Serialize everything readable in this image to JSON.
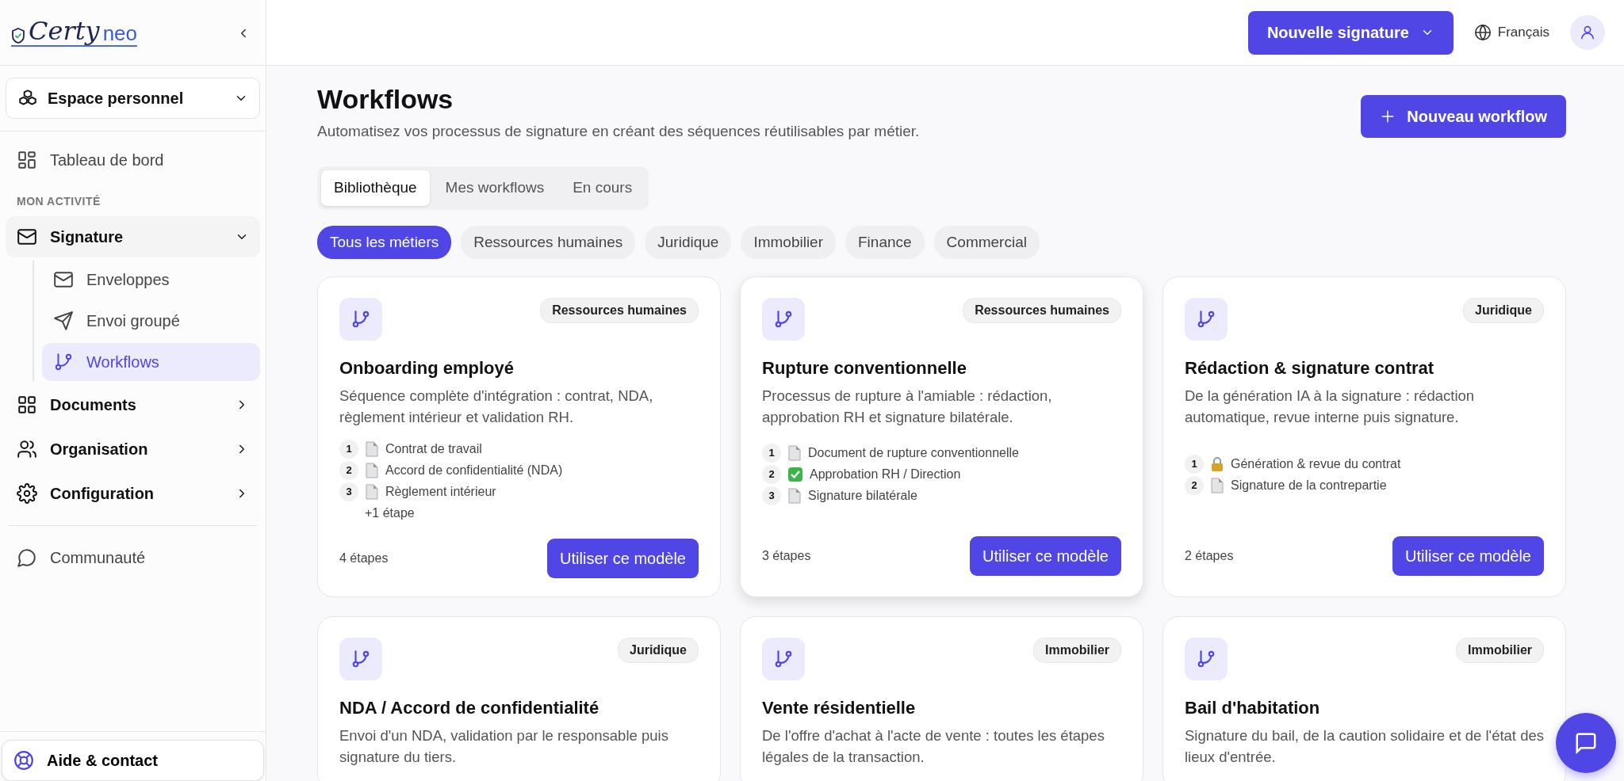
{
  "sidebar": {
    "logo": {
      "part_1": "Certy",
      "part_2": "neo"
    },
    "workspace": "Espace personnel",
    "nav": [
      {
        "kind": "item",
        "label": "Tableau de bord"
      },
      {
        "kind": "heading",
        "label": "MON ACTIVITÉ"
      },
      {
        "kind": "group",
        "label": "Signature",
        "expanded": true,
        "children": [
          {
            "label": "Enveloppes",
            "selected": false
          },
          {
            "label": "Envoi groupé",
            "selected": false
          },
          {
            "label": "Workflows",
            "selected": true
          }
        ]
      },
      {
        "kind": "group",
        "label": "Documents",
        "expanded": false
      },
      {
        "kind": "group",
        "label": "Organisation",
        "expanded": false
      },
      {
        "kind": "group",
        "label": "Configuration",
        "expanded": false
      },
      {
        "kind": "divider"
      },
      {
        "kind": "item",
        "label": "Communauté"
      }
    ],
    "help": "Aide & contact"
  },
  "header": {
    "new_signature": "Nouvelle signature",
    "language": "Français"
  },
  "page": {
    "title": "Workflows",
    "subtitle": "Automatisez vos processus de signature en créant des séquences réutilisables par métier.",
    "new_workflow": "Nouveau workflow"
  },
  "tabs": [
    {
      "label": "Bibliothèque",
      "selected": true
    },
    {
      "label": "Mes workflows",
      "selected": false
    },
    {
      "label": "En cours",
      "selected": false
    }
  ],
  "filters": [
    {
      "label": "Tous les métiers",
      "selected": true
    },
    {
      "label": "Ressources humaines",
      "selected": false
    },
    {
      "label": "Juridique",
      "selected": false
    },
    {
      "label": "Immobilier",
      "selected": false
    },
    {
      "label": "Finance",
      "selected": false
    },
    {
      "label": "Commercial",
      "selected": false
    }
  ],
  "cards": [
    {
      "category": "Ressources humaines",
      "title": "Onboarding employé",
      "description": "Séquence complète d'intégration : contrat, NDA, règlement intérieur et validation RH.",
      "hovered": false,
      "steps": [
        {
          "number": "1",
          "kind": "document",
          "label": "Contrat de travail"
        },
        {
          "number": "2",
          "kind": "document",
          "label": "Accord de confidentialité (NDA)"
        },
        {
          "number": "3",
          "kind": "document",
          "label": "Règlement intérieur"
        }
      ],
      "more": "+1 étape",
      "count": "4 étapes",
      "button": "Utiliser ce modèle"
    },
    {
      "category": "Ressources humaines",
      "title": "Rupture conventionnelle",
      "description": "Processus de rupture à l'amiable : rédaction, approbation RH et signature bilatérale.",
      "hovered": true,
      "steps": [
        {
          "number": "1",
          "kind": "document",
          "label": "Document de rupture conventionnelle"
        },
        {
          "number": "2",
          "kind": "check",
          "label": "Approbation RH / Direction"
        },
        {
          "number": "3",
          "kind": "document",
          "label": "Signature bilatérale"
        }
      ],
      "count": "3 étapes",
      "button": "Utiliser ce modèle"
    },
    {
      "category": "Juridique",
      "title": "Rédaction & signature contrat",
      "description": "De la génération IA à la signature : rédaction automatique, revue interne puis signature.",
      "hovered": false,
      "steps": [
        {
          "number": "1",
          "kind": "lock",
          "label": "Génération & revue du contrat"
        },
        {
          "number": "2",
          "kind": "document",
          "label": "Signature de la contrepartie"
        }
      ],
      "count": "2 étapes",
      "button": "Utiliser ce modèle"
    },
    {
      "category": "Juridique",
      "title": "NDA / Accord de confidentialité",
      "description": "Envoi d'un NDA, validation par le responsable puis signature du tiers.",
      "hovered": false
    },
    {
      "category": "Immobilier",
      "title": "Vente résidentielle",
      "description": "De l'offre d'achat à l'acte de vente : toutes les étapes légales de la transaction.",
      "hovered": false
    },
    {
      "category": "Immobilier",
      "title": "Bail d'habitation",
      "description": "Signature du bail, de la caution solidaire et de l'état des lieux d'entrée.",
      "hovered": false
    }
  ]
}
